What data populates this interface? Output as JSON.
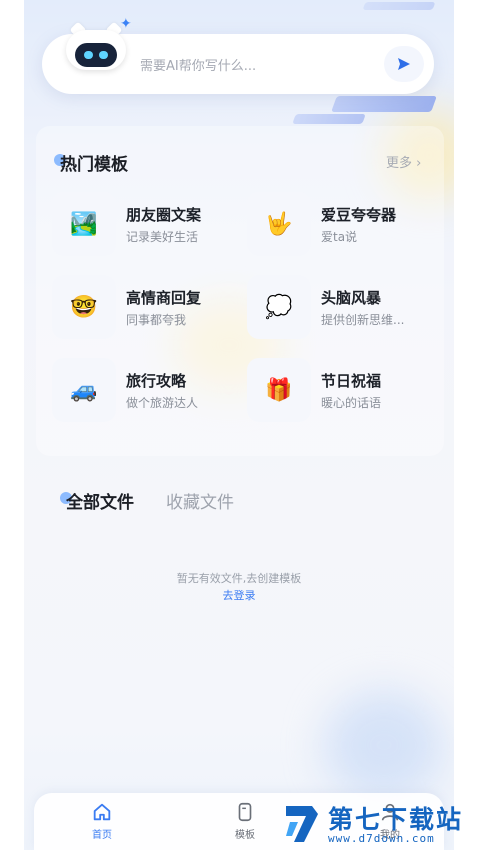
{
  "ai_input": {
    "placeholder": "需要AI帮你写什么..."
  },
  "hot_templates": {
    "title": "热门模板",
    "more": "更多 ›",
    "items": [
      {
        "name": "朋友圈文案",
        "desc": "记录美好生活",
        "icon": "landscape-picture-icon",
        "glyph": "🏞️"
      },
      {
        "name": "爱豆夸夸器",
        "desc": "爱ta说",
        "icon": "love-you-hand-icon",
        "glyph": "🤟"
      },
      {
        "name": "高情商回复",
        "desc": "同事都夸我",
        "icon": "nerd-face-icon",
        "glyph": "🤓"
      },
      {
        "name": "头脑风暴",
        "desc": "提供创新思维...",
        "icon": "thought-bubble-icon",
        "glyph": "💭"
      },
      {
        "name": "旅行攻略",
        "desc": "做个旅游达人",
        "icon": "car-icon",
        "glyph": "🚙"
      },
      {
        "name": "节日祝福",
        "desc": "暖心的话语",
        "icon": "gift-icon",
        "glyph": "🎁"
      }
    ]
  },
  "files": {
    "tabs": [
      "全部文件",
      "收藏文件"
    ],
    "empty_text": "暂无有效文件,去创建模板",
    "login_link": "去登录"
  },
  "bottom_nav": {
    "home": "首页",
    "templates": "模板",
    "me": "我的"
  },
  "watermark": {
    "title": "第七下载站",
    "url": "www.d7down.com"
  },
  "colors": {
    "accent": "#3b7cf2",
    "watermark": "#1565c0"
  }
}
